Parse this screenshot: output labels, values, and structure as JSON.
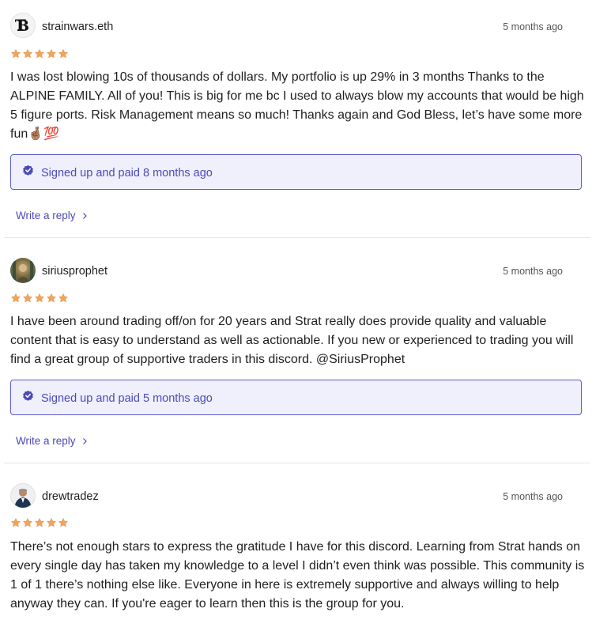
{
  "reviews": [
    {
      "username": "strainwars.eth",
      "timestamp": "5 months ago",
      "rating": 5,
      "text": "I was lost blowing 10s of thousands of dollars. My portfolio is up 29% in 3 months Thanks to the ALPINE FAMILY. All of you! This is big for me bc I used to always blow my accounts that would be high 5 figure ports. Risk Management means so much! Thanks again and God Bless, let’s have some more fun🤞🏽💯",
      "verified": "Signed up and paid 8 months ago",
      "reply_label": "Write a reply",
      "avatar_icon": "tb-monogram-logo"
    },
    {
      "username": "siriusprophet",
      "timestamp": "5 months ago",
      "rating": 5,
      "text": "I have been around trading off/on for 20 years and Strat really does provide quality and valuable content that is easy to understand as well as actionable. If you new or experienced to trading you will find a great group of supportive traders in this discord. @SiriusProphet",
      "verified": "Signed up and paid 5 months ago",
      "reply_label": "Write a reply",
      "avatar_icon": "profile-photo"
    },
    {
      "username": "drewtradez",
      "timestamp": "5 months ago",
      "rating": 5,
      "text": "There’s not enough stars to express the gratitude I have for this discord. Learning from Strat hands on every single day has taken my knowledge to a level I didn’t even think was possible. This community is 1 of 1 there’s nothing else like. Everyone in here is extremely supportive and always willing to help anyway they can. If you're eager to learn then this is the group for you.",
      "avatar_icon": "profile-photo"
    }
  ],
  "colors": {
    "accent": "#4a4ab8",
    "verified_bg": "#f0f0fd",
    "verified_border": "#5b5bc8",
    "star": "#f2a55a",
    "divider": "#e6e6e6"
  }
}
